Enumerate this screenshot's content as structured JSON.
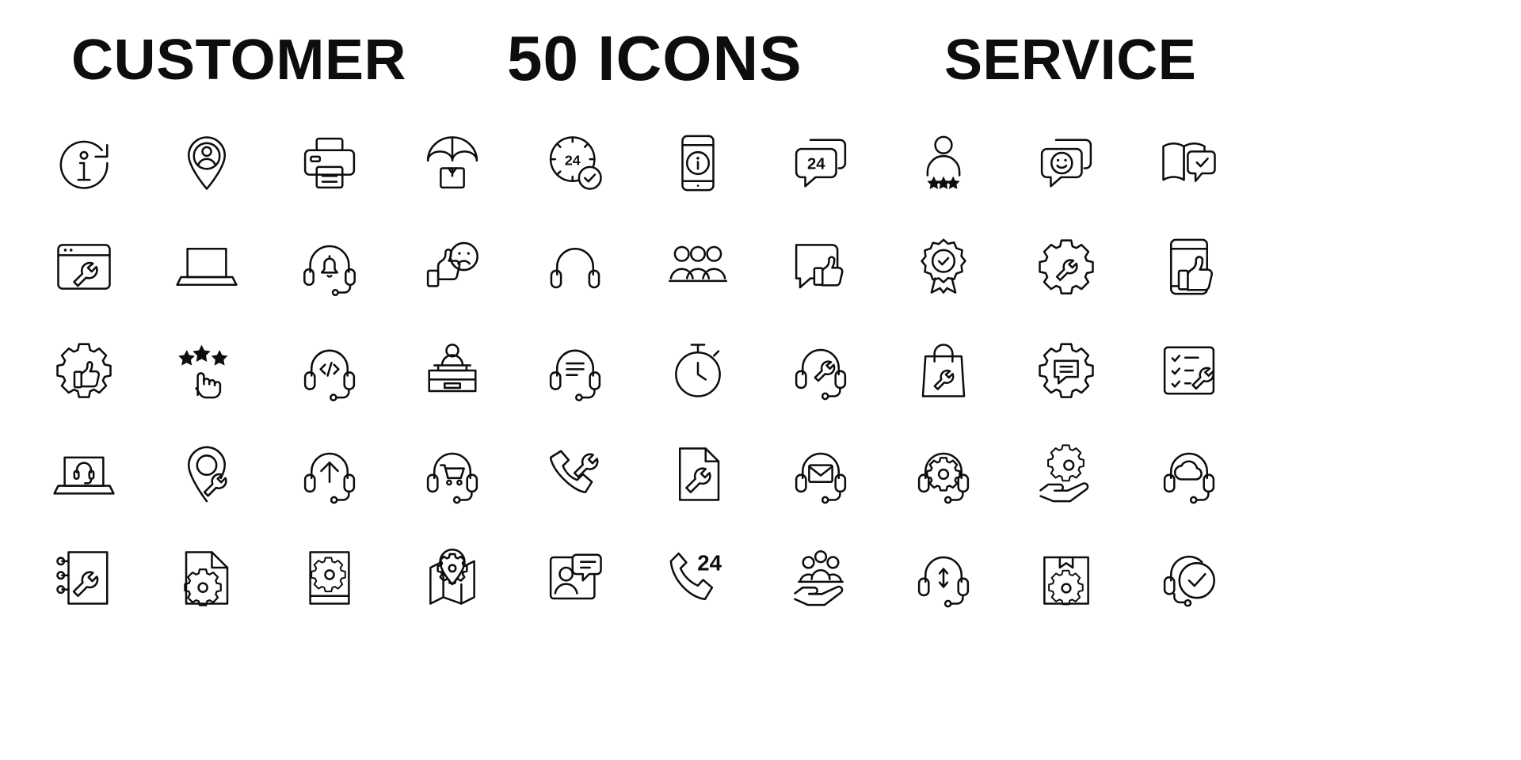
{
  "header": {
    "left_title": "CUSTOMER",
    "center_title": "50 ICONS",
    "right_title": "SERVICE"
  },
  "style": {
    "background": "#ffffff",
    "stroke_color": "#0d0d0d",
    "text_color": "#0d0d0d"
  },
  "grid": {
    "columns": 10,
    "rows": 5,
    "total_icons": 50
  },
  "icons": [
    {
      "id": 1,
      "row": 1,
      "col": 1,
      "name": "info-refresh-icon",
      "label": "24 hour info update"
    },
    {
      "id": 2,
      "row": 1,
      "col": 2,
      "name": "location-user-icon",
      "label": "User location pin"
    },
    {
      "id": 3,
      "row": 1,
      "col": 3,
      "name": "printer-icon",
      "label": "Printer"
    },
    {
      "id": 4,
      "row": 1,
      "col": 4,
      "name": "package-umbrella-icon",
      "label": "Package insurance"
    },
    {
      "id": 5,
      "row": 1,
      "col": 5,
      "name": "clock-24-check-icon",
      "label": "24 hour service confirmed",
      "text": "24"
    },
    {
      "id": 6,
      "row": 1,
      "col": 6,
      "name": "phone-info-icon",
      "label": "Mobile information"
    },
    {
      "id": 7,
      "row": 1,
      "col": 7,
      "name": "chat-24-icon",
      "label": "24 hour chat support",
      "text": "24"
    },
    {
      "id": 8,
      "row": 1,
      "col": 8,
      "name": "user-rating-stars-icon",
      "label": "User star rating"
    },
    {
      "id": 9,
      "row": 1,
      "col": 9,
      "name": "chat-smiley-icon",
      "label": "Positive chat feedback"
    },
    {
      "id": 10,
      "row": 1,
      "col": 10,
      "name": "book-check-icon",
      "label": "Verified manual"
    },
    {
      "id": 11,
      "row": 2,
      "col": 1,
      "name": "browser-wrench-icon",
      "label": "Web support"
    },
    {
      "id": 12,
      "row": 2,
      "col": 2,
      "name": "laptop-icon",
      "label": "Laptop"
    },
    {
      "id": 13,
      "row": 2,
      "col": 3,
      "name": "headset-bell-icon",
      "label": "Support notification"
    },
    {
      "id": 14,
      "row": 2,
      "col": 4,
      "name": "thumbs-up-sad-face-icon",
      "label": "Mixed feedback"
    },
    {
      "id": 15,
      "row": 2,
      "col": 5,
      "name": "headphones-icon",
      "label": "Headphones"
    },
    {
      "id": 16,
      "row": 2,
      "col": 6,
      "name": "people-group-icon",
      "label": "Support team"
    },
    {
      "id": 17,
      "row": 2,
      "col": 7,
      "name": "chat-thumbs-up-icon",
      "label": "Chat approval"
    },
    {
      "id": 18,
      "row": 2,
      "col": 8,
      "name": "award-badge-check-icon",
      "label": "Quality award"
    },
    {
      "id": 19,
      "row": 2,
      "col": 9,
      "name": "gear-wrench-icon",
      "label": "Technical settings"
    },
    {
      "id": 20,
      "row": 2,
      "col": 10,
      "name": "phone-thumbs-up-icon",
      "label": "Mobile approval"
    },
    {
      "id": 21,
      "row": 3,
      "col": 1,
      "name": "gear-thumbs-up-icon",
      "label": "Service approval"
    },
    {
      "id": 22,
      "row": 3,
      "col": 2,
      "name": "stars-click-icon",
      "label": "Rating click"
    },
    {
      "id": 23,
      "row": 3,
      "col": 3,
      "name": "headset-code-icon",
      "label": "Developer support"
    },
    {
      "id": 24,
      "row": 3,
      "col": 4,
      "name": "reception-desk-icon",
      "label": "Reception desk"
    },
    {
      "id": 25,
      "row": 3,
      "col": 5,
      "name": "headset-chat-icon",
      "label": "Live chat agent"
    },
    {
      "id": 26,
      "row": 3,
      "col": 6,
      "name": "stopwatch-icon",
      "label": "Response time"
    },
    {
      "id": 27,
      "row": 3,
      "col": 7,
      "name": "headset-wrench-icon",
      "label": "Technical support"
    },
    {
      "id": 28,
      "row": 3,
      "col": 8,
      "name": "shopping-bag-wrench-icon",
      "label": "Product service"
    },
    {
      "id": 29,
      "row": 3,
      "col": 9,
      "name": "gear-chat-icon",
      "label": "Support settings"
    },
    {
      "id": 30,
      "row": 3,
      "col": 10,
      "name": "checklist-wrench-icon",
      "label": "Maintenance checklist"
    },
    {
      "id": 31,
      "row": 4,
      "col": 1,
      "name": "laptop-headset-icon",
      "label": "Online support"
    },
    {
      "id": 32,
      "row": 4,
      "col": 2,
      "name": "location-wrench-icon",
      "label": "On-site service"
    },
    {
      "id": 33,
      "row": 4,
      "col": 3,
      "name": "headset-upload-icon",
      "label": "Support upload"
    },
    {
      "id": 34,
      "row": 4,
      "col": 4,
      "name": "headset-cart-icon",
      "label": "Shopping support"
    },
    {
      "id": 35,
      "row": 4,
      "col": 5,
      "name": "phone-wrench-icon",
      "label": "Phone repair service"
    },
    {
      "id": 36,
      "row": 4,
      "col": 6,
      "name": "document-wrench-icon",
      "label": "Service document"
    },
    {
      "id": 37,
      "row": 4,
      "col": 7,
      "name": "headset-mail-icon",
      "label": "Email support"
    },
    {
      "id": 38,
      "row": 4,
      "col": 8,
      "name": "headset-gear-icon",
      "label": "Support configuration"
    },
    {
      "id": 39,
      "row": 4,
      "col": 9,
      "name": "hand-gear-icon",
      "label": "Managed service"
    },
    {
      "id": 40,
      "row": 4,
      "col": 10,
      "name": "headset-cloud-icon",
      "label": "Cloud support"
    },
    {
      "id": 41,
      "row": 5,
      "col": 1,
      "name": "notebook-wrench-icon",
      "label": "Service notebook"
    },
    {
      "id": 42,
      "row": 5,
      "col": 2,
      "name": "document-gear-icon",
      "label": "Document settings"
    },
    {
      "id": 43,
      "row": 5,
      "col": 3,
      "name": "book-gear-icon",
      "label": "Service guide"
    },
    {
      "id": 44,
      "row": 5,
      "col": 4,
      "name": "map-pin-gear-icon",
      "label": "Service location map"
    },
    {
      "id": 45,
      "row": 5,
      "col": 5,
      "name": "contact-chat-icon",
      "label": "Contact conversation"
    },
    {
      "id": 46,
      "row": 5,
      "col": 6,
      "name": "phone-24-icon",
      "label": "24 hour hotline",
      "text": "24"
    },
    {
      "id": 47,
      "row": 5,
      "col": 7,
      "name": "hand-people-icon",
      "label": "Customer care"
    },
    {
      "id": 48,
      "row": 5,
      "col": 8,
      "name": "headset-transfer-icon",
      "label": "Call transfer"
    },
    {
      "id": 49,
      "row": 5,
      "col": 9,
      "name": "box-gear-icon",
      "label": "Package service"
    },
    {
      "id": 50,
      "row": 5,
      "col": 10,
      "name": "headset-check-icon",
      "label": "Verified support"
    }
  ]
}
